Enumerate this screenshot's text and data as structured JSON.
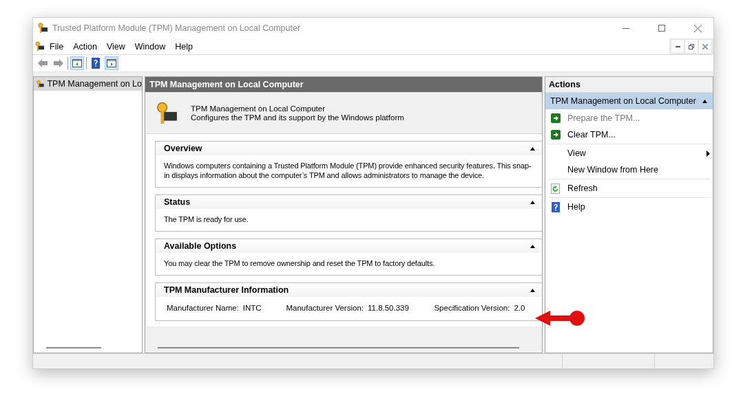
{
  "window": {
    "title": "Trusted Platform Module (TPM) Management on Local Computer"
  },
  "menu": [
    {
      "label": "File"
    },
    {
      "label": "Action"
    },
    {
      "label": "View"
    },
    {
      "label": "Window"
    },
    {
      "label": "Help"
    }
  ],
  "toolbar": [
    {
      "kind": "back",
      "disabled": true
    },
    {
      "kind": "forward",
      "disabled": true
    },
    {
      "kind": "tree",
      "pressed": true
    },
    {
      "kind": "help",
      "pressed": false
    },
    {
      "kind": "actions",
      "pressed": true
    }
  ],
  "tree": [
    {
      "label": "TPM Management on Lo",
      "selected": true
    }
  ],
  "center": {
    "title": "TPM Management on Local Computer",
    "snapin": {
      "title": "TPM Management on Local Computer",
      "subtitle": "Configures the TPM and its support by the Windows platform"
    },
    "sections": [
      {
        "kind": "text",
        "title": "Overview",
        "expanded": true,
        "text": "Windows computers containing a Trusted Platform Module (TPM) provide enhanced security features. This snap-in displays information about the computer’s TPM and allows administrators to manage the device."
      },
      {
        "kind": "text",
        "title": "Status",
        "expanded": true,
        "text": "The TPM is ready for use."
      },
      {
        "kind": "text",
        "title": "Available Options",
        "expanded": true,
        "text": "You may clear the TPM to remove ownership and reset the TPM to factory defaults."
      },
      {
        "kind": "fields",
        "title": "TPM Manufacturer Information",
        "expanded": true,
        "fields": [
          {
            "label": "Manufacturer Name:",
            "value": "INTC"
          },
          {
            "label": "Manufacturer Version:",
            "value": "11.8.50.339"
          },
          {
            "label": "Specification Version:",
            "value": "2.0"
          }
        ]
      }
    ]
  },
  "actions": {
    "title": "Actions",
    "group": {
      "title": "TPM Management on Local Computer",
      "expanded": true
    },
    "item_groups": [
      [
        {
          "kind": "run",
          "label": "Prepare the TPM...",
          "disabled": true
        },
        {
          "kind": "run",
          "label": "Clear TPM...",
          "disabled": false
        }
      ],
      [
        {
          "kind": "submenu",
          "label": "View",
          "disabled": false
        },
        {
          "kind": "plain",
          "label": "New Window from Here",
          "disabled": false
        }
      ],
      [
        {
          "kind": "refresh",
          "label": "Refresh",
          "disabled": false
        }
      ],
      [
        {
          "kind": "help",
          "label": "Help",
          "disabled": false
        }
      ]
    ]
  }
}
